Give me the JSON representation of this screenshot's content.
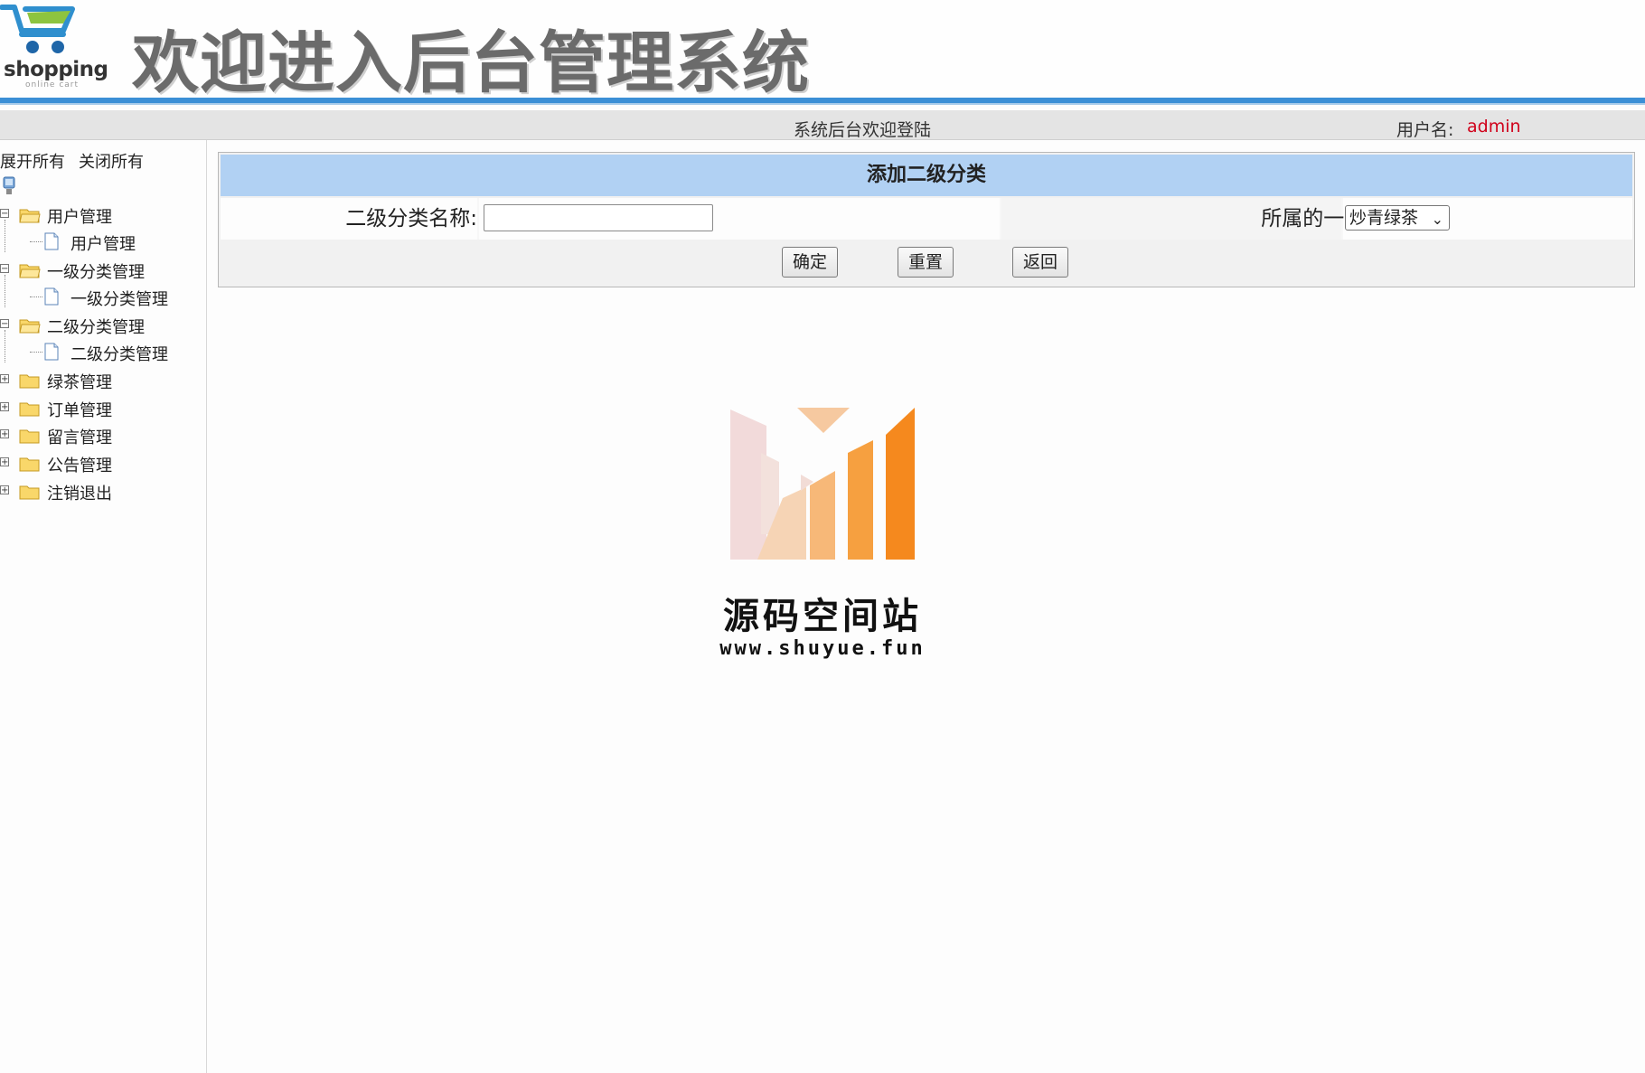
{
  "header": {
    "logo_word": "shopping",
    "logo_sub": "online cart",
    "title": "欢迎进入后台管理系统"
  },
  "status_bar": {
    "welcome": "系统后台欢迎登陆",
    "user_label": "用户名:",
    "user_name": "admin"
  },
  "sidebar": {
    "expand_all": "展开所有",
    "collapse_all": "关闭所有",
    "groups": [
      {
        "label": "用户管理",
        "expanded": true,
        "child": "用户管理"
      },
      {
        "label": "一级分类管理",
        "expanded": true,
        "child": "一级分类管理"
      },
      {
        "label": "二级分类管理",
        "expanded": true,
        "child": "二级分类管理"
      },
      {
        "label": "绿茶管理",
        "expanded": false
      },
      {
        "label": "订单管理",
        "expanded": false
      },
      {
        "label": "留言管理",
        "expanded": false
      },
      {
        "label": "公告管理",
        "expanded": false
      },
      {
        "label": "注销退出",
        "expanded": false
      }
    ]
  },
  "form": {
    "title": "添加二级分类",
    "name_label": "二级分类名称:",
    "name_value": "",
    "parent_label": "所属的一级分类:",
    "parent_selected": "炒青绿茶",
    "buttons": {
      "confirm": "确定",
      "reset": "重置",
      "back": "返回"
    }
  },
  "watermark": {
    "title": "源码空间站",
    "url": "www.shuyue.fun"
  },
  "colors": {
    "accent_blue": "#3b8fd6",
    "form_header": "#b1d1f3",
    "user_name": "#d0021b",
    "watermark_orange": "#f5891e"
  }
}
